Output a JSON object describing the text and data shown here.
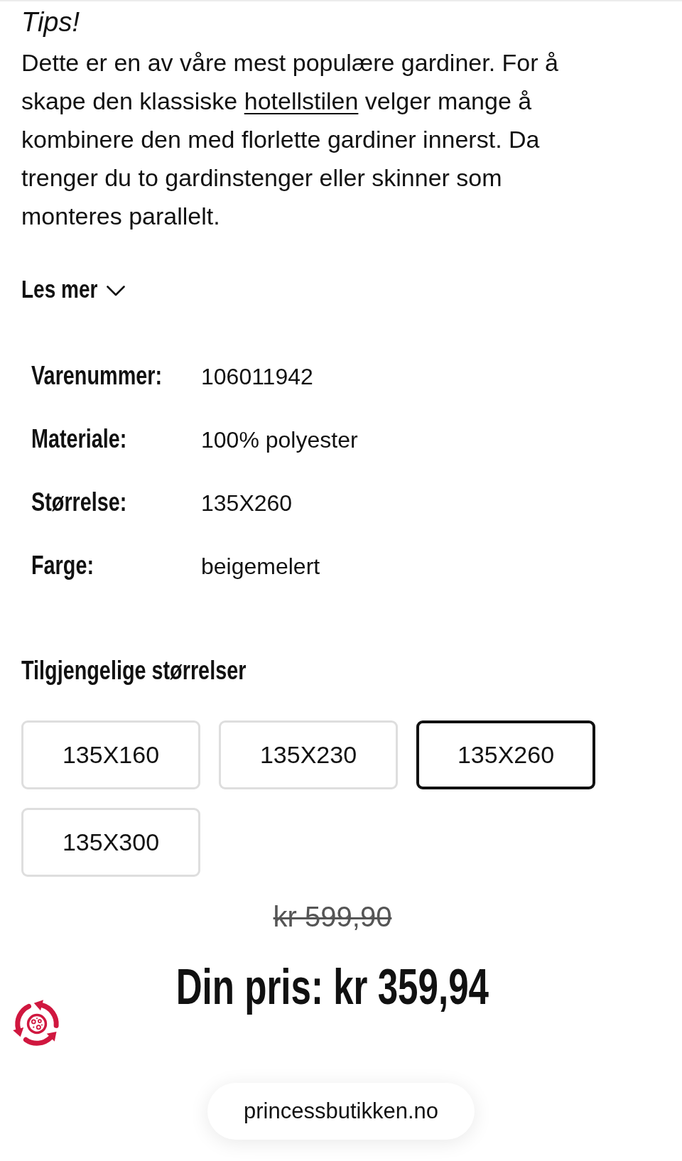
{
  "tips": {
    "title": "Tips!",
    "text_before": "Dette er en av våre mest populære gardiner. For å skape den klassiske",
    "link": "hotellstilen",
    "text_after": "velger mange å kombinere den med florlette gardiner innerst. Da trenger du to gardinstenger eller skinner som monteres parallelt."
  },
  "read_more": {
    "label": "Les mer",
    "expanded": false
  },
  "details": [
    {
      "label": "Varenummer:",
      "value": "106011942"
    },
    {
      "label": "Materiale:",
      "value": "100% polyester"
    },
    {
      "label": "Størrelse:",
      "value": "135X260"
    },
    {
      "label": "Farge:",
      "value": "beigemelert"
    }
  ],
  "sizes": {
    "title": "Tilgjengelige størrelser",
    "options": [
      {
        "label": "135X160",
        "selected": false
      },
      {
        "label": "135X230",
        "selected": false
      },
      {
        "label": "135X260",
        "selected": true
      },
      {
        "label": "135X300",
        "selected": false
      }
    ]
  },
  "price": {
    "original": "kr 599,90",
    "current": "Din pris: kr 359,94"
  },
  "address_bar": {
    "url": "princessbutikken.no"
  }
}
